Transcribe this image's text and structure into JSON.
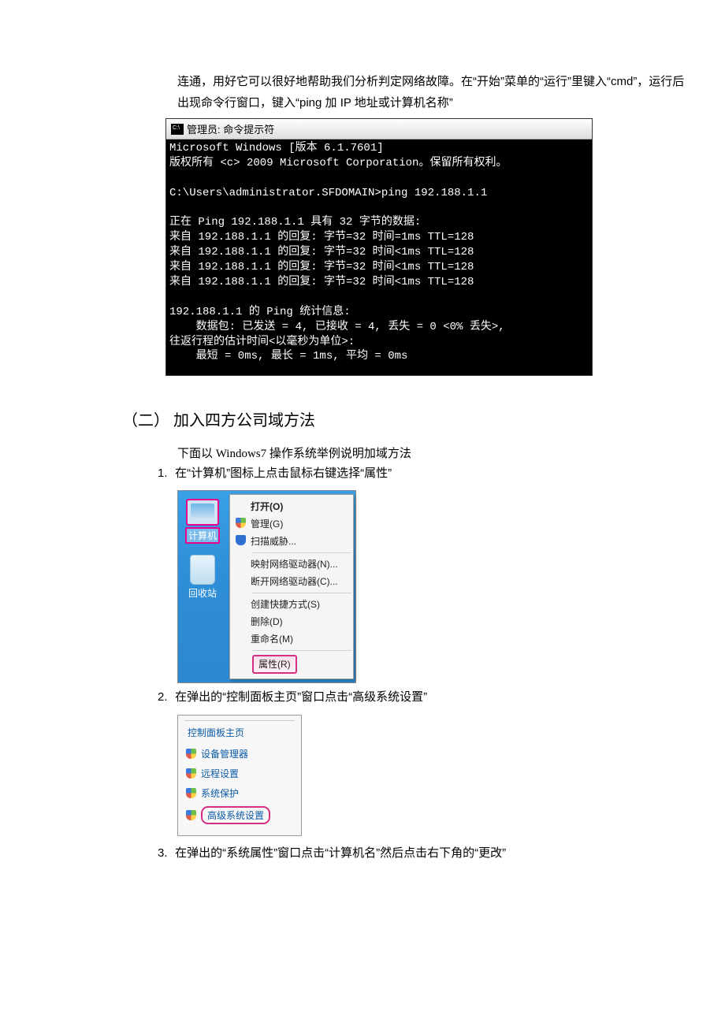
{
  "intro": "连通，用好它可以很好地帮助我们分析判定网络故障。在“开始”菜单的“运行”里键入“cmd”，运行后出现命令行窗口，键入“ping 加 IP 地址或计算机名称”",
  "cmd": {
    "title": "管理员: 命令提示符",
    "lines": [
      "Microsoft Windows [版本 6.1.7601]",
      "版权所有 <c> 2009 Microsoft Corporation。保留所有权利。",
      "",
      "C:\\Users\\administrator.SFDOMAIN>ping 192.188.1.1",
      "",
      "正在 Ping 192.188.1.1 具有 32 字节的数据:",
      "来自 192.188.1.1 的回复: 字节=32 时间=1ms TTL=128",
      "来自 192.188.1.1 的回复: 字节=32 时间<1ms TTL=128",
      "来自 192.188.1.1 的回复: 字节=32 时间<1ms TTL=128",
      "来自 192.188.1.1 的回复: 字节=32 时间<1ms TTL=128",
      "",
      "192.188.1.1 的 Ping 统计信息:",
      "    数据包: 已发送 = 4, 已接收 = 4, 丢失 = 0 <0% 丢失>,",
      "往返行程的估计时间<以毫秒为单位>:",
      "    最短 = 0ms, 最长 = 1ms, 平均 = 0ms"
    ]
  },
  "section2": {
    "heading": "（二） 加入四方公司域方法",
    "intro": "下面以 Windows7 操作系统举例说明加域方法",
    "steps": {
      "s1": {
        "num": "1.",
        "text": "在“计算机”图标上点击鼠标右键选择“属性”"
      },
      "s2": {
        "num": "2.",
        "text": "在弹出的“控制面板主页”窗口点击“高级系统设置”"
      },
      "s3": {
        "num": "3.",
        "text": "在弹出的“系统属性”窗口点击“计算机名”然后点击右下角的“更改”"
      }
    }
  },
  "desktop": {
    "iconComputer": "计算机",
    "iconRecycle": "回收站",
    "menu": {
      "open": "打开(O)",
      "manage": "管理(G)",
      "scan": "扫描威胁...",
      "mapDrive": "映射网络驱动器(N)...",
      "disconnect": "断开网络驱动器(C)...",
      "shortcut": "创建快捷方式(S)",
      "delete": "删除(D)",
      "rename": "重命名(M)",
      "properties": "属性(R)"
    }
  },
  "cp": {
    "title": "控制面板主页",
    "deviceMgr": "设备管理器",
    "remote": "远程设置",
    "sysProtect": "系统保护",
    "advanced": "高级系统设置"
  }
}
